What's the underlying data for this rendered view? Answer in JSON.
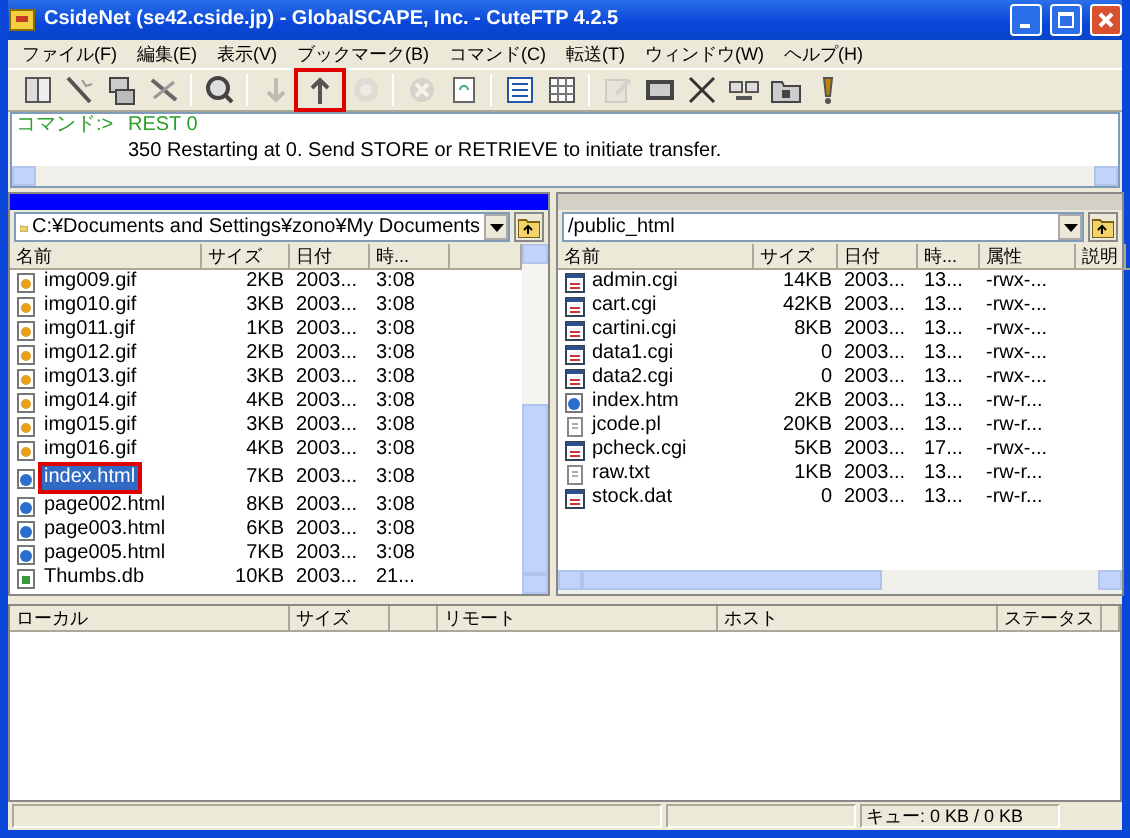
{
  "window": {
    "title": "CsideNet (se42.cside.jp) - GlobalSCAPE, Inc. - CuteFTP 4.2.5"
  },
  "menu": [
    "ファイル(F)",
    "編集(E)",
    "表示(V)",
    "ブックマーク(B)",
    "コマンド(C)",
    "転送(T)",
    "ウィンドウ(W)",
    "ヘルプ(H)"
  ],
  "toolbar": [
    {
      "kind": "book",
      "disabled": false,
      "highlighted": false
    },
    {
      "kind": "connect",
      "disabled": false,
      "highlighted": false
    },
    {
      "kind": "sites",
      "disabled": false,
      "highlighted": false
    },
    {
      "kind": "disconnect",
      "disabled": false,
      "highlighted": false
    },
    {
      "kind": "separator"
    },
    {
      "kind": "find",
      "disabled": false,
      "highlighted": false
    },
    {
      "kind": "separator"
    },
    {
      "kind": "download",
      "disabled": true,
      "highlighted": false
    },
    {
      "kind": "upload",
      "disabled": false,
      "highlighted": true
    },
    {
      "kind": "reconnect",
      "disabled": true,
      "highlighted": false
    },
    {
      "kind": "separator"
    },
    {
      "kind": "stop",
      "disabled": true,
      "highlighted": false
    },
    {
      "kind": "refresh",
      "disabled": false,
      "highlighted": false
    },
    {
      "kind": "separator"
    },
    {
      "kind": "list",
      "disabled": false,
      "highlighted": false
    },
    {
      "kind": "details",
      "disabled": false,
      "highlighted": false
    },
    {
      "kind": "separator"
    },
    {
      "kind": "edit",
      "disabled": true,
      "highlighted": false
    },
    {
      "kind": "rel",
      "disabled": false,
      "highlighted": false
    },
    {
      "kind": "delete",
      "disabled": false,
      "highlighted": false
    },
    {
      "kind": "link",
      "disabled": false,
      "highlighted": false
    },
    {
      "kind": "folder",
      "disabled": false,
      "highlighted": false
    },
    {
      "kind": "bang",
      "disabled": false,
      "highlighted": false
    }
  ],
  "command_log": [
    {
      "prompt": "コマンド:>",
      "text": "REST 0"
    },
    {
      "text": "350 Restarting at 0. Send STORE or RETRIEVE to initiate transfer."
    }
  ],
  "local_pane": {
    "active": true,
    "path": "C:¥Documents and Settings¥zono¥My Documents",
    "columns": [
      "名前",
      "サイズ",
      "日付",
      "時..."
    ],
    "rows": [
      {
        "kind": "image",
        "name": "img009.gif",
        "size": "2KB",
        "date": "2003...",
        "time": "3:08",
        "selected": false,
        "highlighted": false
      },
      {
        "kind": "image",
        "name": "img010.gif",
        "size": "3KB",
        "date": "2003...",
        "time": "3:08",
        "selected": false,
        "highlighted": false
      },
      {
        "kind": "image",
        "name": "img011.gif",
        "size": "1KB",
        "date": "2003...",
        "time": "3:08",
        "selected": false,
        "highlighted": false
      },
      {
        "kind": "image",
        "name": "img012.gif",
        "size": "2KB",
        "date": "2003...",
        "time": "3:08",
        "selected": false,
        "highlighted": false
      },
      {
        "kind": "image",
        "name": "img013.gif",
        "size": "3KB",
        "date": "2003...",
        "time": "3:08",
        "selected": false,
        "highlighted": false
      },
      {
        "kind": "image",
        "name": "img014.gif",
        "size": "4KB",
        "date": "2003...",
        "time": "3:08",
        "selected": false,
        "highlighted": false
      },
      {
        "kind": "image",
        "name": "img015.gif",
        "size": "3KB",
        "date": "2003...",
        "time": "3:08",
        "selected": false,
        "highlighted": false
      },
      {
        "kind": "image",
        "name": "img016.gif",
        "size": "4KB",
        "date": "2003...",
        "time": "3:08",
        "selected": false,
        "highlighted": false
      },
      {
        "kind": "web",
        "name": "index.html",
        "size": "7KB",
        "date": "2003...",
        "time": "3:08",
        "selected": true,
        "highlighted": true
      },
      {
        "kind": "web",
        "name": "page002.html",
        "size": "8KB",
        "date": "2003...",
        "time": "3:08",
        "selected": false,
        "highlighted": false
      },
      {
        "kind": "web",
        "name": "page003.html",
        "size": "6KB",
        "date": "2003...",
        "time": "3:08",
        "selected": false,
        "highlighted": false
      },
      {
        "kind": "web",
        "name": "page005.html",
        "size": "7KB",
        "date": "2003...",
        "time": "3:08",
        "selected": false,
        "highlighted": false
      },
      {
        "kind": "database",
        "name": "Thumbs.db",
        "size": "10KB",
        "date": "2003...",
        "time": "21...",
        "selected": false,
        "highlighted": false
      }
    ]
  },
  "remote_pane": {
    "active": false,
    "path": "/public_html",
    "columns": [
      "名前",
      "サイズ",
      "日付",
      "時...",
      "属性",
      "説明"
    ],
    "rows": [
      {
        "kind": "script",
        "name": "admin.cgi",
        "size": "14KB",
        "date": "2003...",
        "time": "13...",
        "attributes": "-rwx-..."
      },
      {
        "kind": "script",
        "name": "cart.cgi",
        "size": "42KB",
        "date": "2003...",
        "time": "13...",
        "attributes": "-rwx-..."
      },
      {
        "kind": "script",
        "name": "cartini.cgi",
        "size": "8KB",
        "date": "2003...",
        "time": "13...",
        "attributes": "-rwx-..."
      },
      {
        "kind": "script",
        "name": "data1.cgi",
        "size": "0",
        "date": "2003...",
        "time": "13...",
        "attributes": "-rwx-..."
      },
      {
        "kind": "script",
        "name": "data2.cgi",
        "size": "0",
        "date": "2003...",
        "time": "13...",
        "attributes": "-rwx-..."
      },
      {
        "kind": "web",
        "name": "index.htm",
        "size": "2KB",
        "date": "2003...",
        "time": "13...",
        "attributes": "-rw-r..."
      },
      {
        "kind": "text",
        "name": "jcode.pl",
        "size": "20KB",
        "date": "2003...",
        "time": "13...",
        "attributes": "-rw-r..."
      },
      {
        "kind": "script",
        "name": "pcheck.cgi",
        "size": "5KB",
        "date": "2003...",
        "time": "17...",
        "attributes": "-rwx-..."
      },
      {
        "kind": "text",
        "name": "raw.txt",
        "size": "1KB",
        "date": "2003...",
        "time": "13...",
        "attributes": "-rw-r..."
      },
      {
        "kind": "script",
        "name": "stock.dat",
        "size": "0",
        "date": "2003...",
        "time": "13...",
        "attributes": "-rw-r..."
      }
    ]
  },
  "queue": {
    "columns": [
      "ローカル",
      "サイズ",
      null,
      "リモート",
      "ホスト",
      "ステータス"
    ]
  },
  "status_bar": {
    "queue": "キュー: 0 KB / 0 KB"
  }
}
